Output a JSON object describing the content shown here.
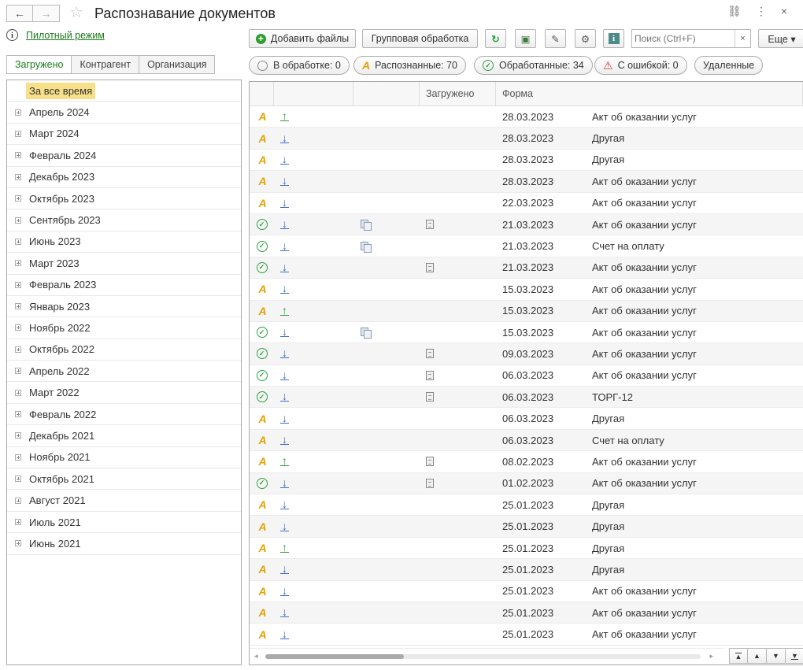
{
  "header": {
    "title": "Распознавание документов",
    "back_label": "←",
    "forward_label": "→",
    "star": "☆",
    "link_icon": "⛓",
    "more_icon": "⋮",
    "close_icon": "×"
  },
  "pilot": {
    "icon": "i",
    "link": "Пилотный режим"
  },
  "tabs": [
    "Загружено",
    "Контрагент",
    "Организация"
  ],
  "tree": {
    "all_label": "За все время",
    "items": [
      "Апрель 2024",
      "Март 2024",
      "Февраль 2024",
      "Декабрь 2023",
      "Октябрь 2023",
      "Сентябрь 2023",
      "Июнь 2023",
      "Март 2023",
      "Февраль 2023",
      "Январь 2023",
      "Ноябрь 2022",
      "Октябрь 2022",
      "Апрель 2022",
      "Март 2022",
      "Февраль 2022",
      "Декабрь 2021",
      "Ноябрь 2021",
      "Октябрь 2021",
      "Август 2021",
      "Июль 2021",
      "Июнь 2021"
    ]
  },
  "toolbar": {
    "add_files": "Добавить файлы",
    "group_processing": "Групповая обработка",
    "refresh_icon": "↻",
    "image_icon": "▣",
    "clip_icon": "✎",
    "settings_icon": "⚙",
    "info_icon": "i",
    "search_placeholder": "Поиск (Ctrl+F)",
    "search_clear": "×",
    "more_label": "Еще ▾"
  },
  "filters": {
    "processing": "В обработке: 0",
    "recognized": "Распознанные: 70",
    "processed": "Обработанные: 34",
    "errors": "С ошибкой: 0",
    "deleted": "Удаленные"
  },
  "filter_colors": {
    "recognized": "#e8a000",
    "processed": "#2ea043",
    "errors": "#d9342b",
    "processing_icon": "#888888"
  },
  "grid": {
    "headers": [
      "",
      "",
      "",
      "Загружено",
      "Форма"
    ],
    "rows": [
      {
        "status": "recognized",
        "dir": "up",
        "copy": false,
        "doc": false,
        "date": "28.03.2023",
        "form": "Акт об оказании услуг"
      },
      {
        "status": "recognized",
        "dir": "down",
        "copy": false,
        "doc": false,
        "date": "28.03.2023",
        "form": "Другая"
      },
      {
        "status": "recognized",
        "dir": "down",
        "copy": false,
        "doc": false,
        "date": "28.03.2023",
        "form": "Другая"
      },
      {
        "status": "recognized",
        "dir": "down",
        "copy": false,
        "doc": false,
        "date": "28.03.2023",
        "form": "Акт об оказании услуг"
      },
      {
        "status": "recognized",
        "dir": "down",
        "copy": false,
        "doc": false,
        "date": "22.03.2023",
        "form": "Акт об оказании услуг"
      },
      {
        "status": "processed",
        "dir": "down",
        "copy": true,
        "doc": true,
        "date": "21.03.2023",
        "form": "Акт об оказании услуг"
      },
      {
        "status": "processed",
        "dir": "down",
        "copy": true,
        "doc": false,
        "date": "21.03.2023",
        "form": "Счет на оплату"
      },
      {
        "status": "processed",
        "dir": "down",
        "copy": false,
        "doc": true,
        "date": "21.03.2023",
        "form": "Акт об оказании услуг"
      },
      {
        "status": "recognized",
        "dir": "down",
        "copy": false,
        "doc": false,
        "date": "15.03.2023",
        "form": "Акт об оказании услуг"
      },
      {
        "status": "recognized",
        "dir": "up",
        "copy": false,
        "doc": false,
        "date": "15.03.2023",
        "form": "Акт об оказании услуг"
      },
      {
        "status": "processed",
        "dir": "down",
        "copy": true,
        "doc": false,
        "date": "15.03.2023",
        "form": "Акт об оказании услуг"
      },
      {
        "status": "processed",
        "dir": "down",
        "copy": false,
        "doc": true,
        "date": "09.03.2023",
        "form": "Акт об оказании услуг"
      },
      {
        "status": "processed",
        "dir": "down",
        "copy": false,
        "doc": true,
        "date": "06.03.2023",
        "form": "Акт об оказании услуг"
      },
      {
        "status": "processed",
        "dir": "down",
        "copy": false,
        "doc": true,
        "date": "06.03.2023",
        "form": "ТОРГ-12"
      },
      {
        "status": "recognized",
        "dir": "down",
        "copy": false,
        "doc": false,
        "date": "06.03.2023",
        "form": "Другая"
      },
      {
        "status": "recognized",
        "dir": "down",
        "copy": false,
        "doc": false,
        "date": "06.03.2023",
        "form": "Счет на оплату"
      },
      {
        "status": "recognized",
        "dir": "up",
        "copy": false,
        "doc": true,
        "date": "08.02.2023",
        "form": "Акт об оказании услуг"
      },
      {
        "status": "processed",
        "dir": "down",
        "copy": false,
        "doc": true,
        "date": "01.02.2023",
        "form": "Акт об оказании услуг"
      },
      {
        "status": "recognized",
        "dir": "down",
        "copy": false,
        "doc": false,
        "date": "25.01.2023",
        "form": "Другая"
      },
      {
        "status": "recognized",
        "dir": "down",
        "copy": false,
        "doc": false,
        "date": "25.01.2023",
        "form": "Другая"
      },
      {
        "status": "recognized",
        "dir": "up",
        "copy": false,
        "doc": false,
        "date": "25.01.2023",
        "form": "Другая"
      },
      {
        "status": "recognized",
        "dir": "down",
        "copy": false,
        "doc": false,
        "date": "25.01.2023",
        "form": "Другая"
      },
      {
        "status": "recognized",
        "dir": "down",
        "copy": false,
        "doc": false,
        "date": "25.01.2023",
        "form": "Акт об оказании услуг"
      },
      {
        "status": "recognized",
        "dir": "down",
        "copy": false,
        "doc": false,
        "date": "25.01.2023",
        "form": "Акт об оказании услуг"
      },
      {
        "status": "recognized",
        "dir": "down",
        "copy": false,
        "doc": false,
        "date": "25.01.2023",
        "form": "Акт об оказании услуг"
      }
    ]
  },
  "pager": {
    "first": "▲",
    "prev": "▲",
    "next": "▼",
    "last": "▼"
  }
}
